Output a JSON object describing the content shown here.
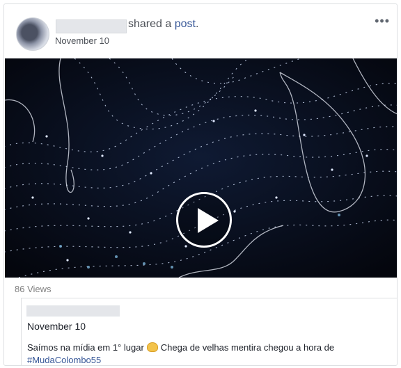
{
  "post": {
    "shared_text": "shared a",
    "shared_link": "post",
    "shared_period": ".",
    "date": "November 10",
    "more_icon": "•••"
  },
  "video": {
    "views": "86 Views",
    "play_icon": "play-icon"
  },
  "quoted": {
    "date": "November 10",
    "text_before": "Saímos na mídia em 1° lugar",
    "text_after": "Chega de velhas mentira chegou a hora de",
    "hashtag": "#MudaColombo55",
    "emoji": "clapping-hands"
  },
  "colors": {
    "link": "#385898",
    "muted": "#7f7f7f",
    "video_bg": "#070b18"
  }
}
